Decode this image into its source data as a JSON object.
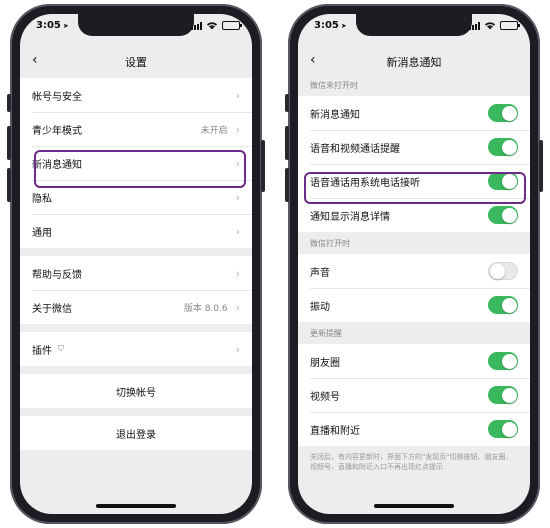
{
  "status_bar": {
    "time": "3:05",
    "battery_level": 0.8
  },
  "left": {
    "title": "设置",
    "group1": [
      {
        "label": "帐号与安全",
        "value": ""
      },
      {
        "label": "青少年模式",
        "value": "未开启"
      },
      {
        "label": "新消息通知",
        "value": ""
      },
      {
        "label": "隐私",
        "value": ""
      },
      {
        "label": "通用",
        "value": ""
      }
    ],
    "group2": [
      {
        "label": "帮助与反馈",
        "value": ""
      },
      {
        "label": "关于微信",
        "value": "版本 8.0.6"
      }
    ],
    "plugin_label": "插件",
    "switch_account": "切换帐号",
    "logout": "退出登录"
  },
  "right": {
    "title": "新消息通知",
    "section1_header": "微信未打开时",
    "section1": [
      {
        "label": "新消息通知",
        "on": true
      },
      {
        "label": "语音和视频通话提醒",
        "on": true
      },
      {
        "label": "语音通话用系统电话接听",
        "on": true
      },
      {
        "label": "通知显示消息详情",
        "on": true
      }
    ],
    "section2_header": "微信打开时",
    "section2": [
      {
        "label": "声音",
        "on": false
      },
      {
        "label": "振动",
        "on": true
      }
    ],
    "section3_header": "更新提醒",
    "section3": [
      {
        "label": "朋友圈",
        "on": true
      },
      {
        "label": "视频号",
        "on": true
      },
      {
        "label": "直播和附近",
        "on": true
      }
    ],
    "footnote": "关闭后，有内容更新时，界面下方的\"发现页\"切换按钮、朋友圈、视频号、直播和附近入口不再出现红点提示"
  },
  "colors": {
    "toggle_on": "#3bb85e",
    "highlight": "#6e2c8a"
  }
}
